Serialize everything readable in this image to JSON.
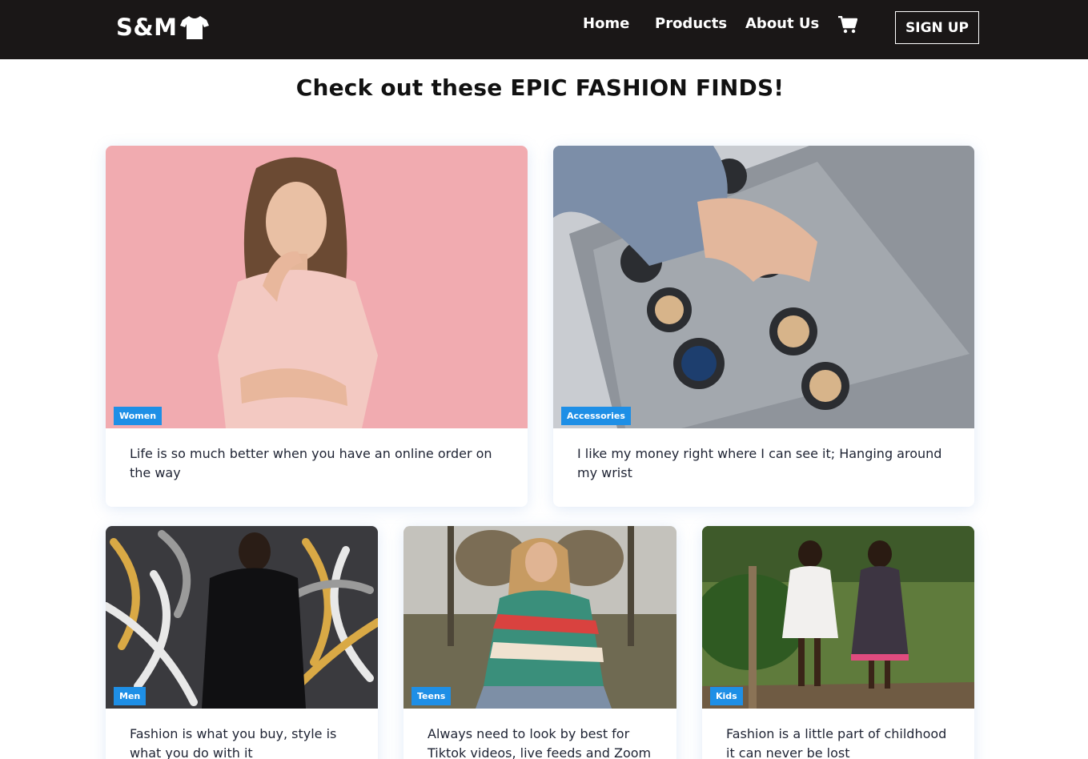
{
  "header": {
    "brand": "S&M",
    "logo_icon": "t-shirt-icon",
    "nav": [
      "Home",
      "Products",
      "About Us"
    ],
    "cart_icon": "shopping-cart-icon",
    "signup_label": "SIGN UP"
  },
  "main": {
    "title": "Check out these EPIC FASHION FINDS!",
    "cards": [
      {
        "tag": "Women",
        "text": "Life is so much better when you have an online order on the way"
      },
      {
        "tag": "Accessories",
        "text": "I like my money right where I can see it; Hanging around my wrist"
      },
      {
        "tag": "Men",
        "text": "Fashion is what you buy, style is what you do with it"
      },
      {
        "tag": "Teens",
        "text": "Always need to look by best for Tiktok videos, live feeds and Zoom"
      },
      {
        "tag": "Kids",
        "text": "Fashion is a little part of childhood it can never be lost"
      }
    ]
  },
  "colors": {
    "header_bg": "#1a1717",
    "tag_bg": "#1e8fe6"
  }
}
